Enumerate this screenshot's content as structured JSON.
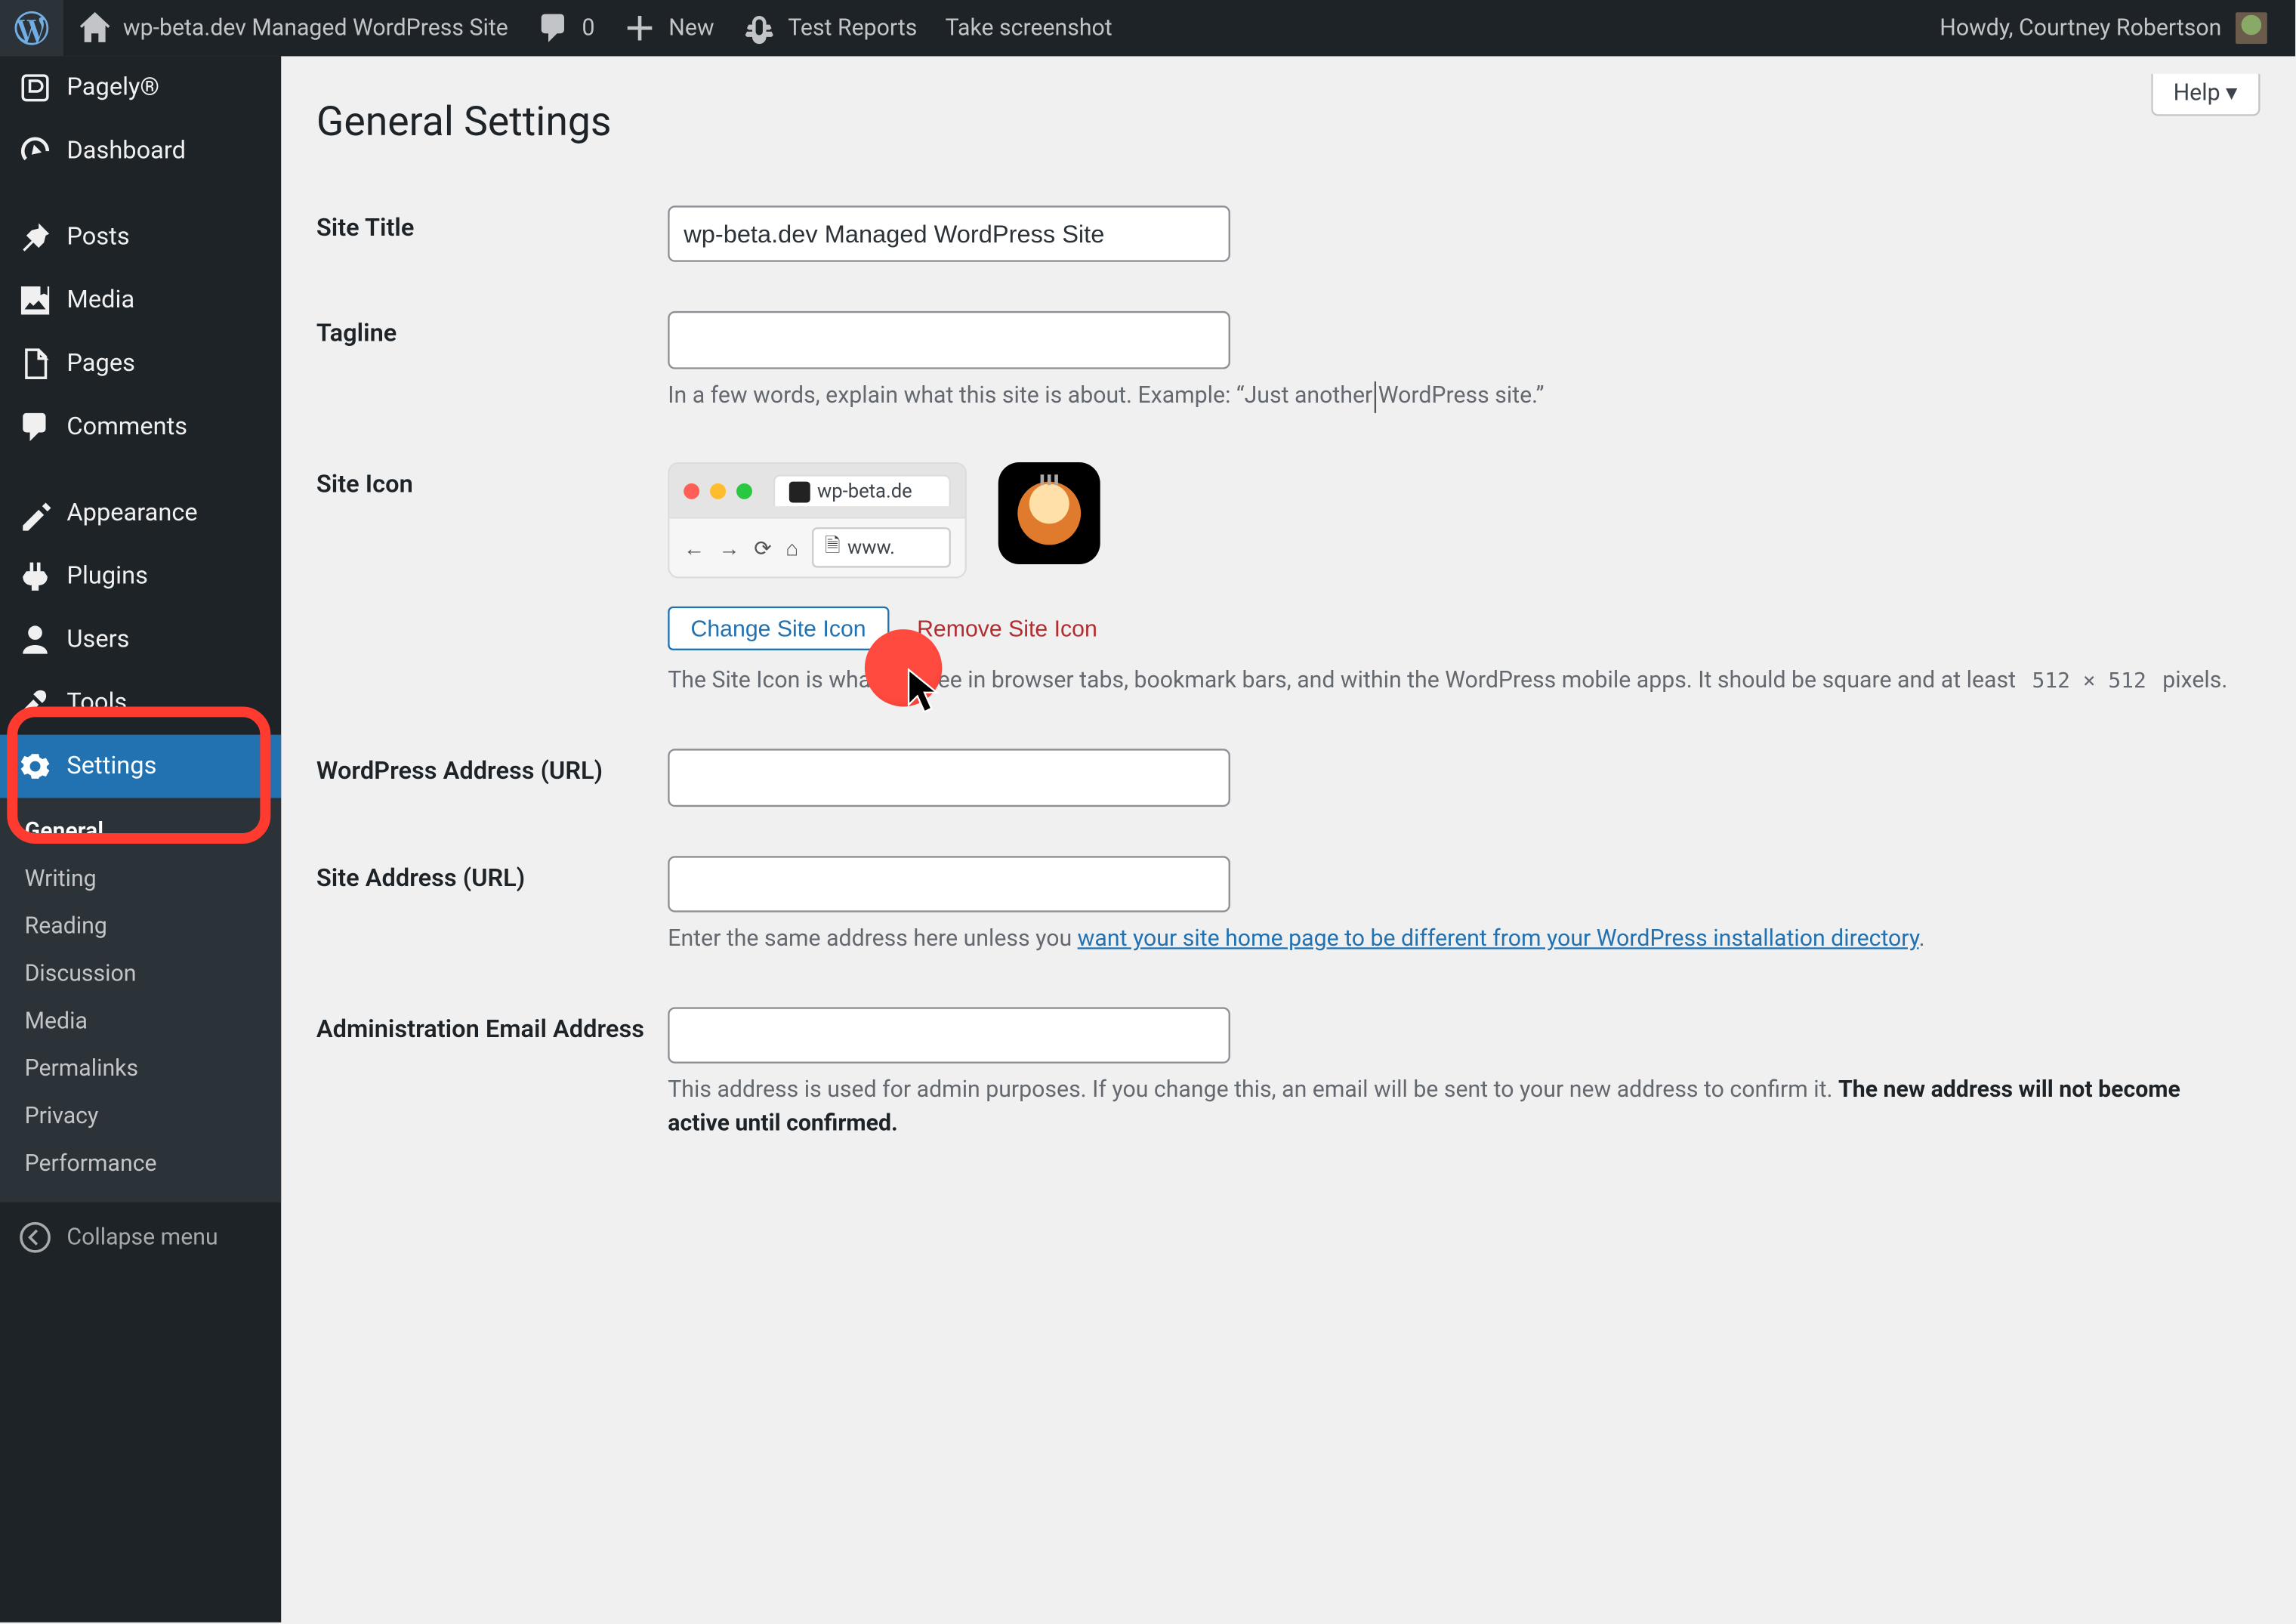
{
  "adminbar": {
    "site_title": "wp-beta.dev Managed WordPress Site",
    "comments_count": "0",
    "new_label": "New",
    "test_reports_label": "Test Reports",
    "screenshot_label": "Take screenshot",
    "greeting": "Howdy, Courtney Robertson"
  },
  "help_label": "Help ▾",
  "page_title": "General Settings",
  "sidebar": {
    "pagely": "Pagely®",
    "dashboard": "Dashboard",
    "posts": "Posts",
    "media": "Media",
    "pages": "Pages",
    "comments": "Comments",
    "appearance": "Appearance",
    "plugins": "Plugins",
    "users": "Users",
    "tools": "Tools",
    "settings": "Settings",
    "submenu": {
      "general": "General",
      "writing": "Writing",
      "reading": "Reading",
      "discussion": "Discussion",
      "media": "Media",
      "permalinks": "Permalinks",
      "privacy": "Privacy",
      "performance": "Performance"
    },
    "collapse": "Collapse menu"
  },
  "form": {
    "site_title": {
      "label": "Site Title",
      "value": "wp-beta.dev Managed WordPress Site"
    },
    "tagline": {
      "label": "Tagline",
      "value": "",
      "description": "In a few words, explain what this site is about. Example: “Just another WordPress site.”"
    },
    "site_icon": {
      "label": "Site Icon",
      "tab_label": "wp-beta.de",
      "url_text": "www.",
      "change_btn": "Change Site Icon",
      "remove_btn": "Remove Site Icon",
      "desc_part1": "The Site Icon is what you see in browser tabs, bookmark bars, and within the WordPress mobile apps. It should be square and at least ",
      "dimensions": "512 × 512",
      "desc_part2": " pixels."
    },
    "wp_url": {
      "label": "WordPress Address (URL)",
      "value": ""
    },
    "site_url": {
      "label": "Site Address (URL)",
      "value": "",
      "desc_prefix": "Enter the same address here unless you ",
      "desc_link": "want your site home page to be different from your WordPress installation directory",
      "desc_suffix": "."
    },
    "admin_email": {
      "label": "Administration Email Address",
      "value": "",
      "desc_part1": "This address is used for admin purposes. If you change this, an email will be sent to your new address to confirm it. ",
      "desc_bold": "The new address will not become active until confirmed."
    }
  }
}
